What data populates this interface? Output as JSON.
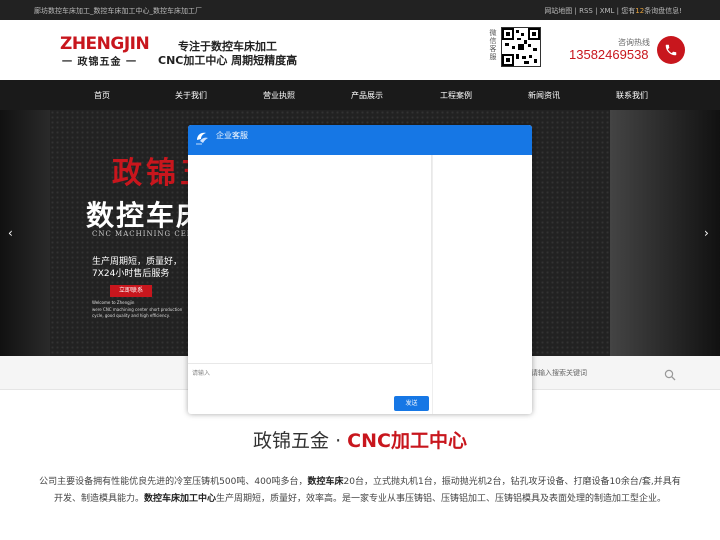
{
  "topbar": {
    "left_text": "廊坊数控车床加工_数控车床加工中心_数控车床加工厂",
    "right_links": [
      "网站地图",
      "RSS",
      "XML"
    ],
    "notice_prefix": "您有",
    "notice_count": "12",
    "notice_suffix": "条询盘信息!"
  },
  "header": {
    "logo_en": "ZHENGJIN",
    "logo_cn": "一 政锦五金 一",
    "slogan_line1": "专注于数控车床加工",
    "slogan_line2": "CNC加工中心 周期短精度高",
    "qr_label": "微信客服",
    "hotline_label": "咨询热线",
    "hotline_number": "13582469538",
    "phone_icon": "phone-icon"
  },
  "nav": {
    "items": [
      "首页",
      "关于我们",
      "营业执照",
      "产品展示",
      "工程案例",
      "新闻资讯",
      "联系我们"
    ]
  },
  "banner": {
    "title_red": "政锦五",
    "title_white": "数控车床",
    "subtitle_en": "CNC MACHINING CENTER",
    "line1": "生产周期短，质量好，",
    "line2": "7X24小时售后服务",
    "button": "立即联系",
    "small1": "Welcome to Zhengjin",
    "small2": "were CNC machining center short production cycle, good quality and high efficiency.",
    "prev_arrow": "‹",
    "next_arrow": "›"
  },
  "search": {
    "placeholder": "请输入搜索关键词",
    "icon": "search-icon"
  },
  "section": {
    "title_black": "政锦五金 · ",
    "title_red": "CNC加工中心"
  },
  "intro": {
    "part1": "公司主要设备拥有性能优良先进的冷室压铸机500吨、400吨多台，",
    "bold1": "数控车床",
    "part2": "20台，立式抛丸机1台，振动抛光机2台，钻孔攻牙设备、打磨设备10余台/套,并具有开发、制造模具能力。",
    "bold2": "数控车床加工中心",
    "part3": "生产周期短，质量好，效率高。是一家专业从事压铸铝、压铸铝加工、压铸铝模具及表面处理的制造加工型企业。"
  },
  "chat": {
    "title": "企业客服",
    "input_placeholder": "请输入",
    "send_label": "发送"
  }
}
